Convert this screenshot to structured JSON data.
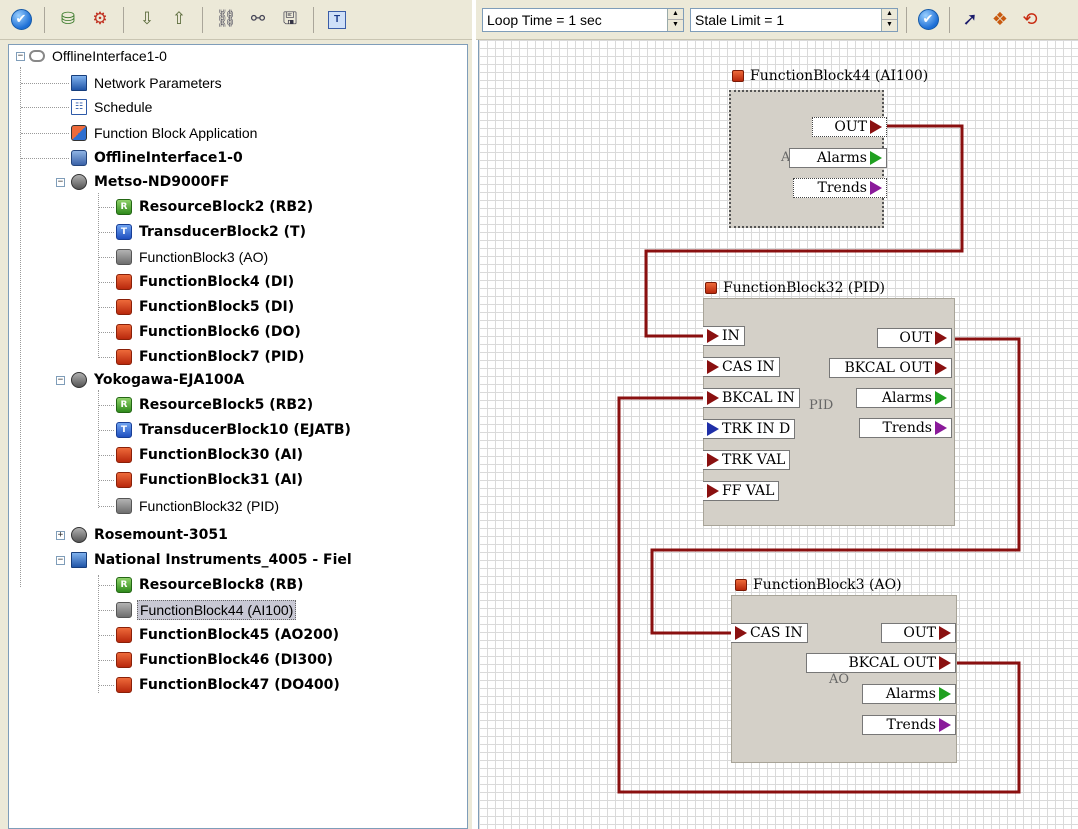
{
  "left_toolbar": {
    "icons": [
      "check-icon",
      "add-device-icon",
      "configure-icon",
      "download-icon",
      "upload-icon",
      "link-icon",
      "unlink-icon",
      "save-icon",
      "tag-icon"
    ]
  },
  "tree": {
    "root": "OfflineInterface1-0",
    "items": [
      {
        "label": "Network Parameters"
      },
      {
        "label": "Schedule"
      },
      {
        "label": "Function Block Application"
      },
      {
        "label": "OfflineInterface1-0"
      },
      {
        "label": "Metso-ND9000FF"
      },
      {
        "label": "ResourceBlock2 (RB2)"
      },
      {
        "label": "TransducerBlock2 (T)"
      },
      {
        "label": "FunctionBlock3 (AO)"
      },
      {
        "label": "FunctionBlock4 (DI)"
      },
      {
        "label": "FunctionBlock5 (DI)"
      },
      {
        "label": "FunctionBlock6 (DO)"
      },
      {
        "label": "FunctionBlock7 (PID)"
      },
      {
        "label": "Yokogawa-EJA100A"
      },
      {
        "label": "ResourceBlock5 (RB2)"
      },
      {
        "label": "TransducerBlock10 (EJATB)"
      },
      {
        "label": "FunctionBlock30 (AI)"
      },
      {
        "label": "FunctionBlock31 (AI)"
      },
      {
        "label": "FunctionBlock32 (PID)"
      },
      {
        "label": "Rosemount-3051"
      },
      {
        "label": "National Instruments_4005 - Fiel"
      },
      {
        "label": "ResourceBlock8 (RB)"
      },
      {
        "label": "FunctionBlock44 (AI100)"
      },
      {
        "label": "FunctionBlock45 (AO200)"
      },
      {
        "label": "FunctionBlock46 (DI300)"
      },
      {
        "label": "FunctionBlock47 (DO400)"
      }
    ]
  },
  "right_toolbar": {
    "loop_time": "Loop Time = 1 sec",
    "stale_limit": "Stale Limit = 1"
  },
  "blocks": {
    "fb44": {
      "title": "FunctionBlock44 (AI100)",
      "out": "OUT",
      "alarms": "Alarms",
      "trends": "Trends",
      "faint": "A"
    },
    "fb32": {
      "title": "FunctionBlock32 (PID)",
      "in": "IN",
      "cas_in": "CAS IN",
      "bkcal_in": "BKCAL IN",
      "trk_in_d": "TRK IN D",
      "trk_val": "TRK VAL",
      "ff_val": "FF VAL",
      "out": "OUT",
      "bkcal_out": "BKCAL OUT",
      "alarms": "Alarms",
      "trends": "Trends",
      "faint": "PID"
    },
    "fb3": {
      "title": "FunctionBlock3 (AO)",
      "cas_in": "CAS IN",
      "out": "OUT",
      "bkcal_out": "BKCAL OUT",
      "alarms": "Alarms",
      "trends": "Trends",
      "faint": "AO"
    }
  },
  "colors": {
    "wire": "#8a1010",
    "canvas_grid": "#dadada",
    "block_body": "#d4d0c8"
  }
}
